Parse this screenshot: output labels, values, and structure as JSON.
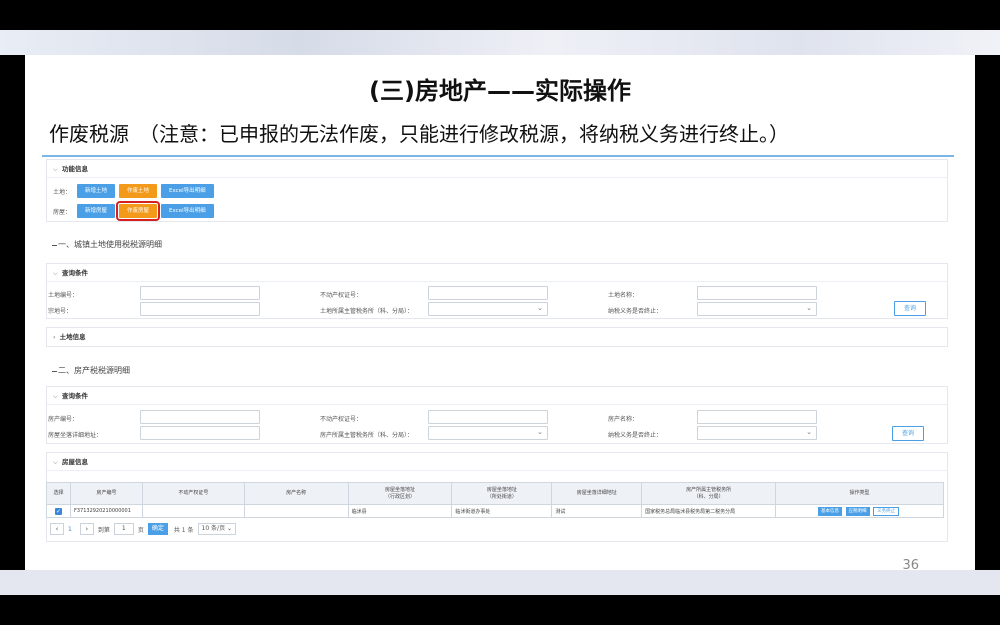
{
  "slide": {
    "title": "(三)房地产——实际操作",
    "subtitle": "作废税源　（注意：已申报的无法作废，只能进行修改税源，将纳税义务进行终止。）",
    "page_number": "36"
  },
  "function_panel": {
    "header": "功能信息",
    "land_label": "土地：",
    "land_buttons": [
      "新增土地",
      "作废土地",
      "Excel导出明细"
    ],
    "house_label": "房屋：",
    "house_buttons": [
      "新增房屋",
      "作废房屋",
      "Excel导出明细"
    ]
  },
  "section1": {
    "title": "一、城镇土地使用税税源明细",
    "query_header": "查询条件",
    "fields": [
      "土地编号：",
      "不动产权证号：",
      "土地名称：",
      "宗地号：",
      "土地所属主管税务所（科、分局）：",
      "纳税义务是否终止："
    ],
    "query_button": "查询",
    "info_header": "土地信息"
  },
  "section2": {
    "title": "二、房产税税源明细",
    "query_header": "查询条件",
    "fields": [
      "房产编号：",
      "不动产权证号：",
      "房产名称：",
      "房屋坐落详细地址：",
      "房产所属主管税务所（科、分局）：",
      "纳税义务是否终止："
    ],
    "query_button": "查询",
    "info_header": "房屋信息"
  },
  "table": {
    "headers": [
      "选择",
      "房产编号",
      "不动产权证号",
      "房产名称",
      "房屋坐落地址\n（行政区划）",
      "房屋坐落地址\n（所处街道）",
      "房屋坐落详细地址",
      "房产所属主管税务所\n（科、分局）",
      "操作类型"
    ],
    "row": {
      "id": "F37132920210000001",
      "cert": "",
      "name": "",
      "district": "临沭县",
      "street": "临沭街道办事处",
      "detail": "测试",
      "office": "国家税务总局临沭县税务局第二税务分局",
      "actions": [
        "基本信息",
        "应税明细",
        "义务终止"
      ]
    }
  },
  "pager": {
    "current": "1",
    "goto_label": "到第",
    "goto_value": "1",
    "page_unit": "页",
    "confirm": "确定",
    "total": "共 1 条",
    "page_size": "10 条/页"
  }
}
